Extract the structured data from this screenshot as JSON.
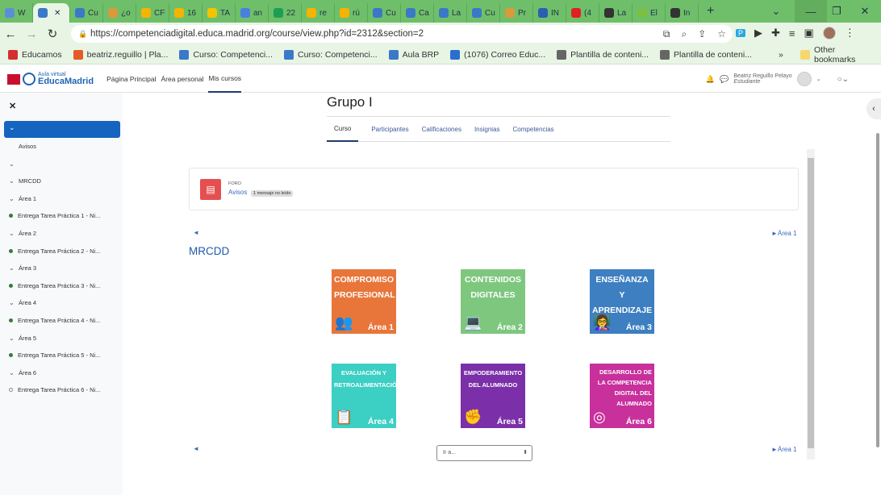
{
  "browser": {
    "tabs": [
      "W",
      "",
      "Cu",
      "¿o",
      "CF",
      "16",
      "TA",
      "an",
      "22",
      "re",
      "rú",
      "Cu",
      "Ca",
      "La",
      "Cu",
      "Pr",
      "IN",
      "(4",
      "La",
      "El",
      "In"
    ],
    "active_tab_index": 1,
    "url": "https://competenciadigital.educa.madrid.org/course/view.php?id=2312&section=2",
    "bookmarks": [
      "Educamos",
      "beatriz.reguillo | Pla...",
      "Curso: Competenci...",
      "Curso: Competenci...",
      "Aula BRP",
      "(1076) Correo Educ...",
      "Plantilla de conteni...",
      "Plantilla de conteni..."
    ],
    "other_bookmarks": "Other bookmarks"
  },
  "header": {
    "logo_small": "Aula virtual",
    "logo_big": "EducaMadrid",
    "nav": [
      "Página Principal",
      "Área personal",
      "Mis cursos"
    ],
    "user_name": "Beatriz Reguillo Pelayo",
    "user_role": "Estudiante"
  },
  "sidebar": {
    "items": [
      {
        "label": "Avisos",
        "type": "sub"
      },
      {
        "label": "",
        "type": "section"
      },
      {
        "label": "MRCDD",
        "type": "section"
      },
      {
        "label": "Área 1",
        "type": "section"
      },
      {
        "label": "Entrega Tarea Práctica 1 - Ni...",
        "type": "done"
      },
      {
        "label": "Área 2",
        "type": "section"
      },
      {
        "label": "Entrega Tarea Práctica 2 - Ni...",
        "type": "done"
      },
      {
        "label": "Área 3",
        "type": "section"
      },
      {
        "label": "Entrega Tarea Práctica 3 - Ni...",
        "type": "done"
      },
      {
        "label": "Área 4",
        "type": "section"
      },
      {
        "label": "Entrega Tarea Práctica 4 - Ni...",
        "type": "done"
      },
      {
        "label": "Área 5",
        "type": "section"
      },
      {
        "label": "Entrega Tarea Práctica 5 - Ni...",
        "type": "done"
      },
      {
        "label": "Área 6",
        "type": "section"
      },
      {
        "label": "Entrega Tarea Práctica 6 - Ni...",
        "type": "todo"
      }
    ]
  },
  "course": {
    "title": "Grupo I",
    "tabs": [
      "Curso",
      "Participantes",
      "Calificaciones",
      "Insignias",
      "Competencias"
    ],
    "forum": {
      "type": "FORO",
      "name": "Avisos",
      "badge": "1 mensaje no leído"
    },
    "prev": "◄",
    "next": "►Área 1",
    "section_title": "MRCDD",
    "tiles": [
      {
        "name": "COMPROMISO PROFESIONAL",
        "area": "Área 1",
        "color": "#e8763a",
        "icon": "👥"
      },
      {
        "name": "CONTENIDOS DIGITALES",
        "area": "Área 2",
        "color": "#7ec77e",
        "icon": "💻"
      },
      {
        "name": "ENSEÑANZA Y APRENDIZAJE",
        "area": "Área 3",
        "color": "#3d7fc1",
        "icon": "👩‍🏫"
      },
      {
        "name": "EVALUACIÓN Y RETROALIMENTACIÓN",
        "area": "Área 4",
        "color": "#3ccfc4",
        "icon": "📋"
      },
      {
        "name": "EMPODERAMIENTO DEL ALUMNADO",
        "area": "Área 5",
        "color": "#7b2fa8",
        "icon": "✊"
      },
      {
        "name": "DESARROLLO DE LA COMPETENCIA DIGITAL DEL ALUMNADO",
        "area": "Área 6",
        "color": "#c8309c",
        "icon": "◎"
      }
    ],
    "goto": "Ir a..."
  }
}
